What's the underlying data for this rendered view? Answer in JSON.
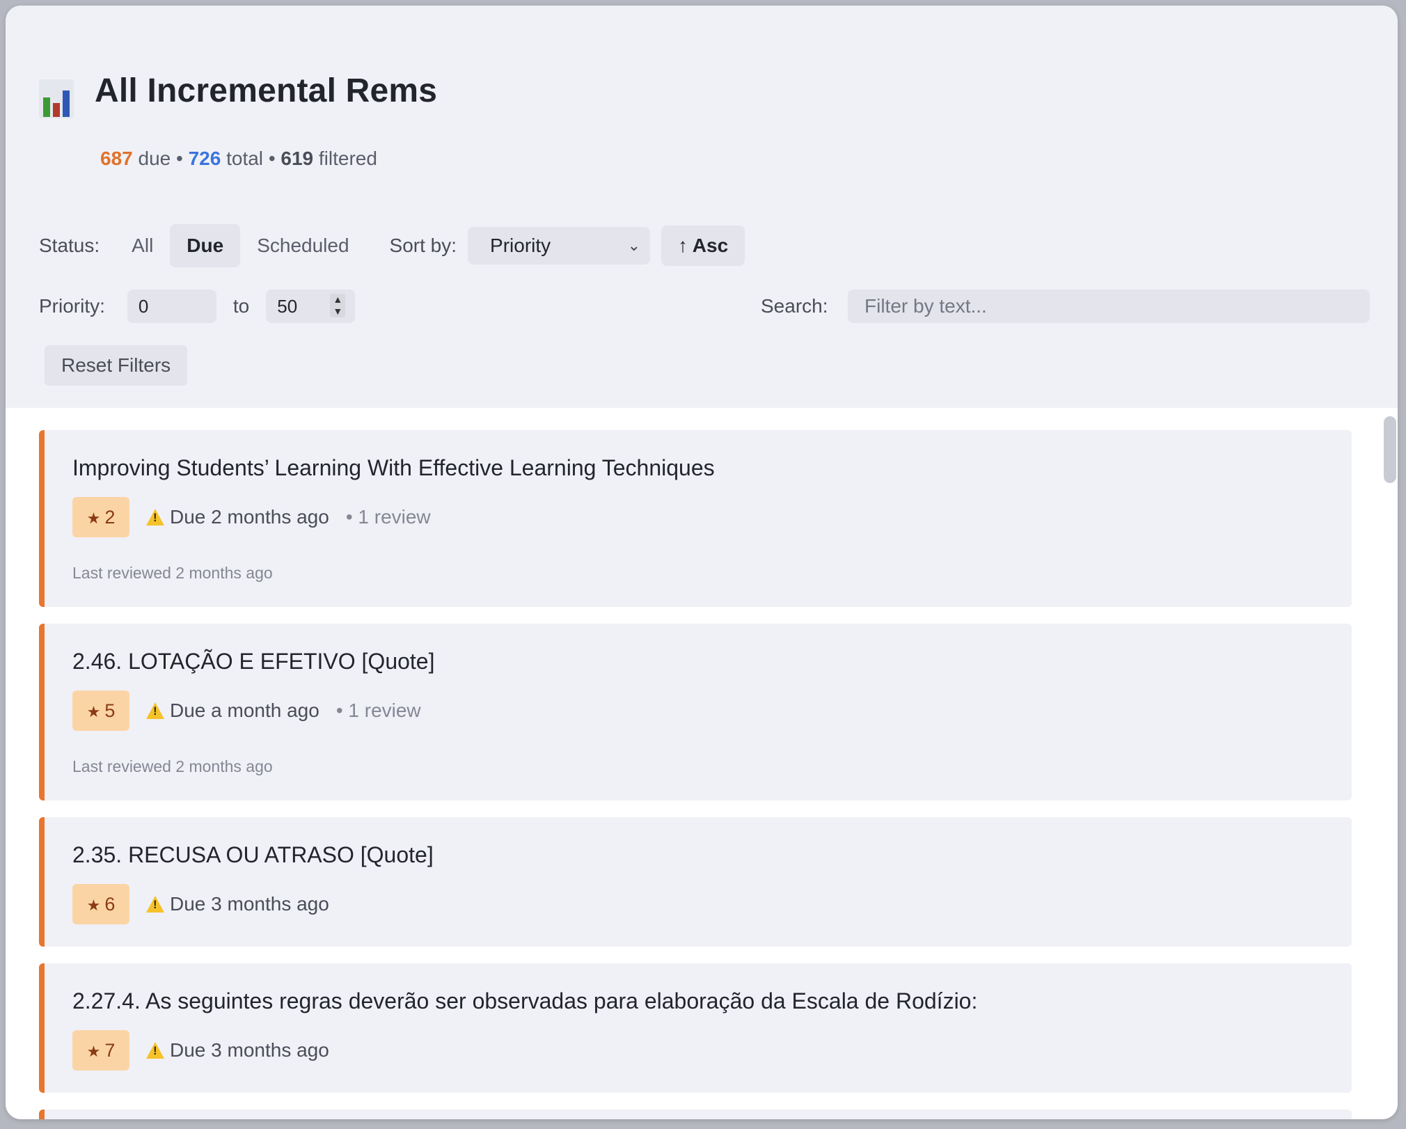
{
  "header": {
    "title": "All Incremental Rems",
    "icon": "bar-chart-icon",
    "stats": {
      "due_count": "687",
      "due_label": "due",
      "sep1": "•",
      "total_count": "726",
      "total_label": "total",
      "sep2": "•",
      "filtered_count": "619",
      "filtered_label": "filtered"
    }
  },
  "filters": {
    "status_label": "Status:",
    "status_options": [
      "All",
      "Due",
      "Scheduled"
    ],
    "status_selected": "Due",
    "sort_label": "Sort by:",
    "sort_value": "Priority",
    "sort_direction": "↑ Asc",
    "priority_label": "Priority:",
    "priority_min": "0",
    "priority_to": "to",
    "priority_max": "50",
    "search_label": "Search:",
    "search_placeholder": "Filter by text...",
    "reset_label": "Reset Filters"
  },
  "items": [
    {
      "title": "Improving Students’ Learning With Effective Learning Techniques",
      "priority": "2",
      "due": "Due 2 months ago",
      "reviews": "• 1 review",
      "last_reviewed": "Last reviewed 2 months ago"
    },
    {
      "title": "2.46. LOTAÇÃO E EFETIVO [Quote]",
      "priority": "5",
      "due": "Due a month ago",
      "reviews": "• 1 review",
      "last_reviewed": "Last reviewed 2 months ago"
    },
    {
      "title": "2.35. RECUSA OU ATRASO [Quote]",
      "priority": "6",
      "due": "Due 3 months ago"
    },
    {
      "title": "2.27.4. As seguintes regras deverão ser observadas para elaboração da Escala de Rodízio:",
      "priority": "7",
      "due": "Due 3 months ago"
    }
  ],
  "colors": {
    "accent_orange": "#e8762e",
    "total_blue": "#3b74df",
    "priority_badge_bg": "#fbd4a6"
  }
}
